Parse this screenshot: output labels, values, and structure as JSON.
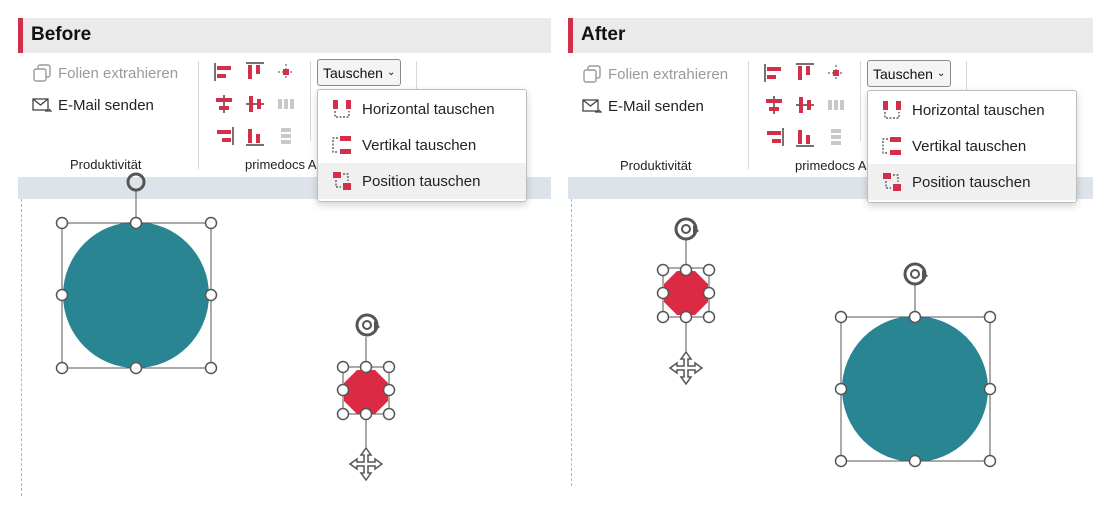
{
  "colors": {
    "accent": "#d32f4a",
    "teal": "#2a8593",
    "red": "#dc2a44"
  },
  "panels": [
    {
      "title": "Before",
      "ribbon": {
        "extract_label": "Folien extrahieren",
        "email_label": "E-Mail senden",
        "group1_label": "Produktivität",
        "group2_label": "primedocs A",
        "dropdown_label": "Tauschen"
      },
      "menu": {
        "items": [
          "Horizontal tauschen",
          "Vertikal tauschen",
          "Position tauschen"
        ],
        "highlighted": "Position tauschen"
      }
    },
    {
      "title": "After",
      "ribbon": {
        "extract_label": "Folien extrahieren",
        "email_label": "E-Mail senden",
        "group1_label": "Produktivität",
        "group2_label": "primedocs A",
        "dropdown_label": "Tauschen"
      },
      "menu": {
        "items": [
          "Horizontal tauschen",
          "Vertikal tauschen",
          "Position tauschen"
        ],
        "highlighted": "Position tauschen"
      }
    }
  ]
}
